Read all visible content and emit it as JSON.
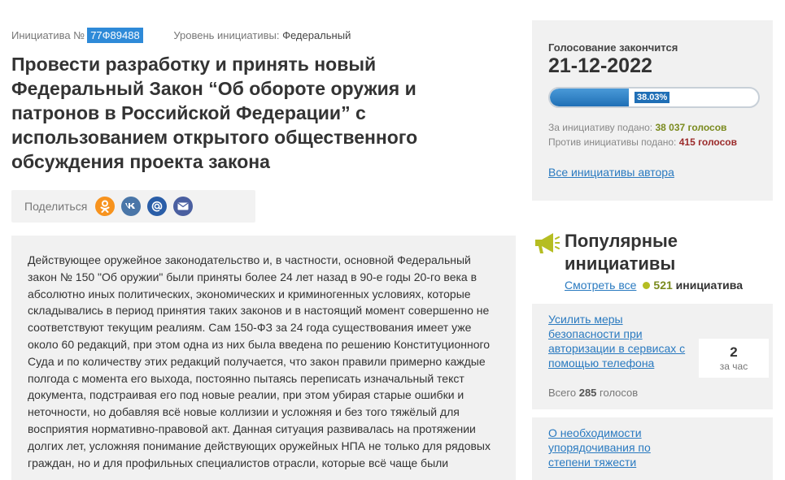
{
  "initiative": {
    "number_label": "Инициатива №",
    "number": "77Ф89488",
    "level_label": "Уровень инициативы:",
    "level": "Федеральный",
    "title": "Провести разработку и принять новый Федеральный Закон “Об обороте оружия и патронов в Российской Федерации” с использованием открытого общественного обсуждения проекта закона",
    "body": "Действующее оружейное законодательство и, в частности, основной Федеральный закон № 150 \"Об оружии\" были приняты более 24 лет назад в 90-е годы 20-го века в абсолютно иных политических, экономических и криминогенных условиях, которые складывались в период принятия таких законов и в настоящий момент совершенно не соответствуют текущим реалиям. Сам 150-ФЗ за 24 года существования имеет уже около 60 редакций, при этом одна из них была введена по решению Конституционного Суда и по количеству этих редакций получается, что закон правили примерно каждые полгода с момента его выхода, постоянно пытаясь переписать изначальный текст документа, подстраивая его под новые реалии, при этом убирая старые ошибки и неточности, но добавляя всё новые коллизии и усложняя и без того тяжёлый для восприятия нормативно-правовой акт. Данная ситуация развивалась на протяжении долгих лет, усложняя понимание действующих оружейных НПА не только для рядовых граждан, но и для профильных специалистов отрасли, которые всё чаще были"
  },
  "share": {
    "label": "Поделиться",
    "icons": [
      "odnoklassniki-icon",
      "vk-icon",
      "mail-icon",
      "email-icon"
    ]
  },
  "voting": {
    "until_label": "Голосование закончится",
    "end_date": "21-12-2022",
    "progress_percent": 38.03,
    "progress_label": "38.03%",
    "for_label": "За инициативу подано:",
    "for_value": "38 037 голосов",
    "against_label": "Против инициативы подано:",
    "against_value": "415 голосов",
    "author_link": "Все инициативы автора"
  },
  "popular": {
    "title": "Популярные инициативы",
    "see_all": "Смотреть все",
    "count": "521",
    "count_word": "инициатива",
    "items": [
      {
        "title": "Усилить меры безопасности при авторизации в сервисах с помощью телефона",
        "rate_value": "2",
        "rate_unit": "за час",
        "total_label": "Всего",
        "total_value": "285",
        "total_unit": "голосов"
      },
      {
        "title": "О необходимости упорядочивания по степени тяжести"
      }
    ]
  },
  "colors": {
    "accent": "#2e8ad8",
    "link": "#2a7ac0",
    "for_votes": "#7a8a1e",
    "against_votes": "#9b2b2b",
    "ok": "#f7931e",
    "vk": "#4a76a8",
    "mail": "#2a5ea8"
  }
}
